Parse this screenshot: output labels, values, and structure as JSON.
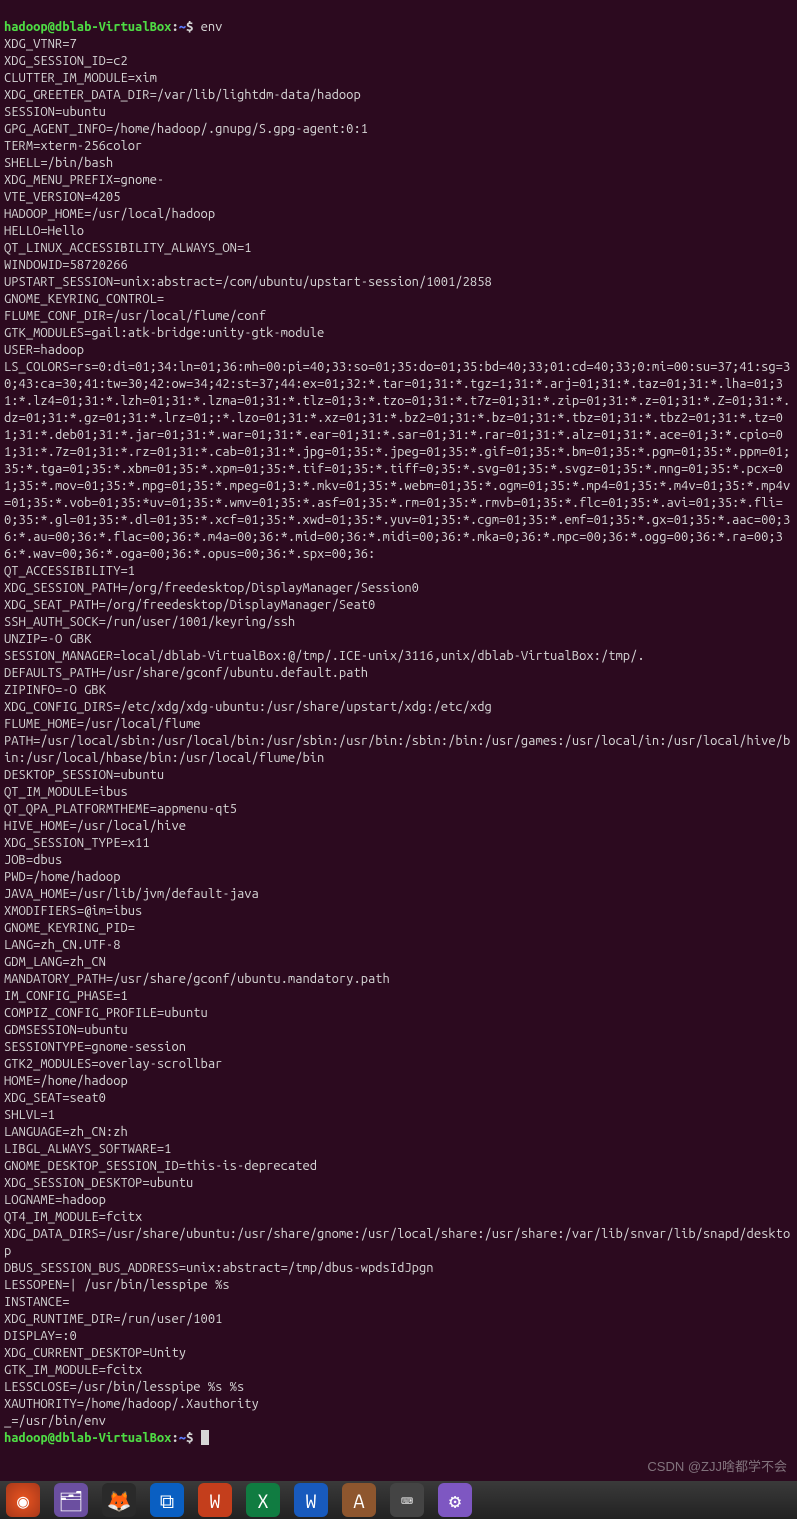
{
  "prompt": {
    "user_host": "hadoop@dblab-VirtualBox",
    "sep1": ":",
    "path": "~",
    "sep2": "$ "
  },
  "command1": "env",
  "output_lines": [
    "XDG_VTNR=7",
    "XDG_SESSION_ID=c2",
    "CLUTTER_IM_MODULE=xim",
    "XDG_GREETER_DATA_DIR=/var/lib/lightdm-data/hadoop",
    "SESSION=ubuntu",
    "GPG_AGENT_INFO=/home/hadoop/.gnupg/S.gpg-agent:0:1",
    "TERM=xterm-256color",
    "SHELL=/bin/bash",
    "XDG_MENU_PREFIX=gnome-",
    "VTE_VERSION=4205",
    "HADOOP_HOME=/usr/local/hadoop",
    "HELLO=Hello",
    "QT_LINUX_ACCESSIBILITY_ALWAYS_ON=1",
    "WINDOWID=58720266",
    "UPSTART_SESSION=unix:abstract=/com/ubuntu/upstart-session/1001/2858",
    "GNOME_KEYRING_CONTROL=",
    "FLUME_CONF_DIR=/usr/local/flume/conf",
    "GTK_MODULES=gail:atk-bridge:unity-gtk-module",
    "USER=hadoop",
    "LS_COLORS=rs=0:di=01;34:ln=01;36:mh=00:pi=40;33:so=01;35:do=01;35:bd=40;33;01:cd=40;33;0:mi=00:su=37;41:sg=30;43:ca=30;41:tw=30;42:ow=34;42:st=37;44:ex=01;32:*.tar=01;31:*.tgz=1;31:*.arj=01;31:*.taz=01;31:*.lha=01;31:*.lz4=01;31:*.lzh=01;31:*.lzma=01;31:*.tlz=01;3:*.tzo=01;31:*.t7z=01;31:*.zip=01;31:*.z=01;31:*.Z=01;31:*.dz=01;31:*.gz=01;31:*.lrz=01;:*.lzo=01;31:*.xz=01;31:*.bz2=01;31:*.bz=01;31:*.tbz=01;31:*.tbz2=01;31:*.tz=01;31:*.deb01;31:*.jar=01;31:*.war=01;31:*.ear=01;31:*.sar=01;31:*.rar=01;31:*.alz=01;31:*.ace=01;3:*.cpio=01;31:*.7z=01;31:*.rz=01;31:*.cab=01;31:*.jpg=01;35:*.jpeg=01;35:*.gif=01;35:*.bm=01;35:*.pgm=01;35:*.ppm=01;35:*.tga=01;35:*.xbm=01;35:*.xpm=01;35:*.tif=01;35:*.tiff=0;35:*.svg=01;35:*.svgz=01;35:*.mng=01;35:*.pcx=01;35:*.mov=01;35:*.mpg=01;35:*.mpeg=01;3:*.mkv=01;35:*.webm=01;35:*.ogm=01;35:*.mp4=01;35:*.m4v=01;35:*.mp4v=01;35:*.vob=01;35:*uv=01;35:*.wmv=01;35:*.asf=01;35:*.rm=01;35:*.rmvb=01;35:*.flc=01;35:*.avi=01;35:*.fli=0;35:*.gl=01;35:*.dl=01;35:*.xcf=01;35:*.xwd=01;35:*.yuv=01;35:*.cgm=01;35:*.emf=01;35:*.gx=01;35:*.aac=00;36:*.au=00;36:*.flac=00;36:*.m4a=00;36:*.mid=00;36:*.midi=00;36:*.mka=0;36:*.mpc=00;36:*.ogg=00;36:*.ra=00;36:*.wav=00;36:*.oga=00;36:*.opus=00;36:*.spx=00;36:",
    "QT_ACCESSIBILITY=1",
    "XDG_SESSION_PATH=/org/freedesktop/DisplayManager/Session0",
    "XDG_SEAT_PATH=/org/freedesktop/DisplayManager/Seat0",
    "SSH_AUTH_SOCK=/run/user/1001/keyring/ssh",
    "UNZIP=-O GBK",
    "SESSION_MANAGER=local/dblab-VirtualBox:@/tmp/.ICE-unix/3116,unix/dblab-VirtualBox:/tmp/.",
    "DEFAULTS_PATH=/usr/share/gconf/ubuntu.default.path",
    "ZIPINFO=-O GBK",
    "XDG_CONFIG_DIRS=/etc/xdg/xdg-ubuntu:/usr/share/upstart/xdg:/etc/xdg",
    "FLUME_HOME=/usr/local/flume",
    "PATH=/usr/local/sbin:/usr/local/bin:/usr/sbin:/usr/bin:/sbin:/bin:/usr/games:/usr/local/in:/usr/local/hive/bin:/usr/local/hbase/bin:/usr/local/flume/bin",
    "DESKTOP_SESSION=ubuntu",
    "QT_IM_MODULE=ibus",
    "QT_QPA_PLATFORMTHEME=appmenu-qt5",
    "HIVE_HOME=/usr/local/hive",
    "XDG_SESSION_TYPE=x11",
    "JOB=dbus",
    "PWD=/home/hadoop",
    "JAVA_HOME=/usr/lib/jvm/default-java",
    "XMODIFIERS=@im=ibus",
    "GNOME_KEYRING_PID=",
    "LANG=zh_CN.UTF-8",
    "GDM_LANG=zh_CN",
    "MANDATORY_PATH=/usr/share/gconf/ubuntu.mandatory.path",
    "IM_CONFIG_PHASE=1",
    "COMPIZ_CONFIG_PROFILE=ubuntu",
    "GDMSESSION=ubuntu",
    "SESSIONTYPE=gnome-session",
    "GTK2_MODULES=overlay-scrollbar",
    "HOME=/home/hadoop",
    "XDG_SEAT=seat0",
    "SHLVL=1",
    "LANGUAGE=zh_CN:zh",
    "LIBGL_ALWAYS_SOFTWARE=1",
    "GNOME_DESKTOP_SESSION_ID=this-is-deprecated",
    "XDG_SESSION_DESKTOP=ubuntu",
    "LOGNAME=hadoop",
    "QT4_IM_MODULE=fcitx",
    "XDG_DATA_DIRS=/usr/share/ubuntu:/usr/share/gnome:/usr/local/share:/usr/share:/var/lib/snvar/lib/snapd/desktop",
    "DBUS_SESSION_BUS_ADDRESS=unix:abstract=/tmp/dbus-wpdsIdJpgn",
    "LESSOPEN=| /usr/bin/lesspipe %s",
    "INSTANCE=",
    "XDG_RUNTIME_DIR=/run/user/1001",
    "DISPLAY=:0",
    "XDG_CURRENT_DESKTOP=Unity",
    "GTK_IM_MODULE=fcitx",
    "LESSCLOSE=/usr/bin/lesspipe %s %s",
    "XAUTHORITY=/home/hadoop/.Xauthority",
    "_=/usr/bin/env"
  ],
  "watermark": "CSDN @ZJJ啥都学不会",
  "taskbar_icons": [
    "dash",
    "files",
    "firefox",
    "sw1",
    "sw2",
    "sw3",
    "sw4",
    "sw5",
    "sw6",
    "sw7"
  ]
}
